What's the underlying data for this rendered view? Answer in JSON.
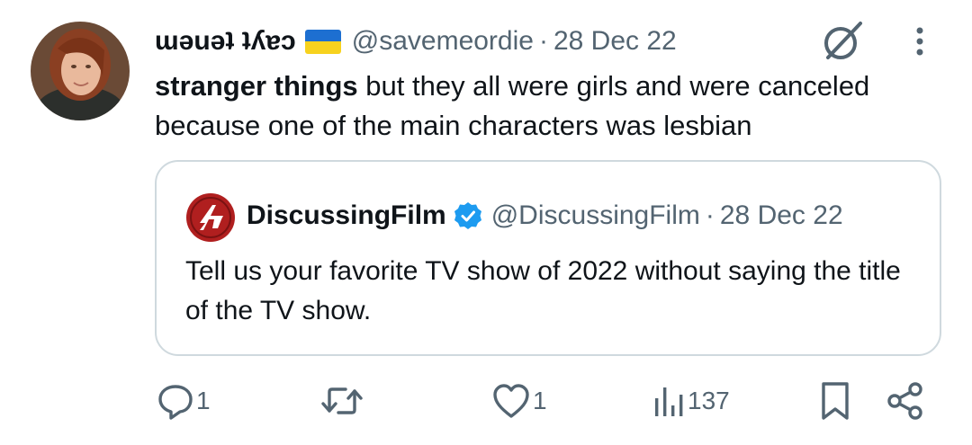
{
  "tweet": {
    "display_name": "ɯəuəʇ ʇʎɐɔ",
    "flag": "ukraine-flag",
    "handle": "@savemeordie",
    "separator": "·",
    "date": "28 Dec 22",
    "text_bold": "stranger things",
    "text_rest": " but they all were girls and were canceled because one of the main characters was lesbian"
  },
  "quote": {
    "display_name": "DiscussingFilm",
    "handle": "@DiscussingFilm",
    "separator": "·",
    "date": "28 Dec 22",
    "text": "Tell us your favorite TV show of 2022 without saying the title of the TV show."
  },
  "actions": {
    "reply_count": "1",
    "retweet_count": "",
    "like_count": "1",
    "views_count": "137"
  },
  "colors": {
    "text_primary": "#0f1419",
    "text_secondary": "#536471",
    "border": "#cfd9de",
    "verified_blue": "#1d9bf0",
    "logo_red": "#b01f1f"
  },
  "icons": [
    "grok-icon",
    "more-icon",
    "verified-icon",
    "reply-icon",
    "retweet-icon",
    "like-icon",
    "views-icon",
    "bookmark-icon",
    "share-icon"
  ]
}
